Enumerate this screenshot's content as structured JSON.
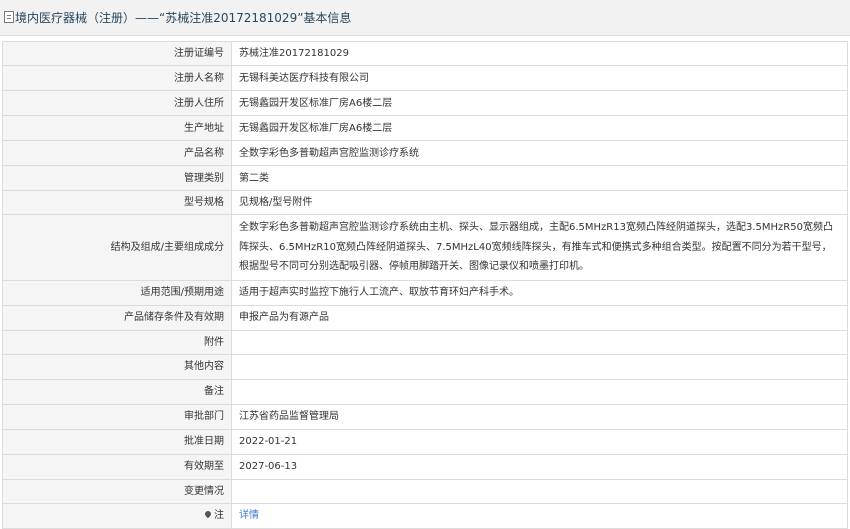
{
  "header": {
    "title": "境内医疗器械（注册）——“苏械注准20172181029”基本信息"
  },
  "rows": [
    {
      "label": "注册证编号",
      "value": "苏械注准20172181029"
    },
    {
      "label": "注册人名称",
      "value": "无锡科美达医疗科技有限公司"
    },
    {
      "label": "注册人住所",
      "value": "无锡蠡园开发区标准厂房A6楼二层"
    },
    {
      "label": "生产地址",
      "value": "无锡蠡园开发区标准厂房A6楼二层"
    },
    {
      "label": "产品名称",
      "value": "全数字彩色多普勒超声宫腔监测诊疗系统"
    },
    {
      "label": "管理类别",
      "value": "第二类"
    },
    {
      "label": "型号规格",
      "value": "见规格/型号附件"
    },
    {
      "label": "结构及组成/主要组成成分",
      "value": "全数字彩色多普勒超声宫腔监测诊疗系统由主机、探头、显示器组成，主配6.5MHzR13宽频凸阵经阴道探头，选配3.5MHzR50宽频凸阵探头、6.5MHzR10宽频凸阵经阴道探头、7.5MHzL40宽频线阵探头，有推车式和便携式多种组合类型。按配置不同分为若干型号，根据型号不同可分别选配吸引器、停帧用脚踏开关、图像记录仪和喷墨打印机。"
    },
    {
      "label": "适用范围/预期用途",
      "value": "适用于超声实时监控下施行人工流产、取放节育环妇产科手术。"
    },
    {
      "label": "产品储存条件及有效期",
      "value": "申报产品为有源产品"
    },
    {
      "label": "附件",
      "value": ""
    },
    {
      "label": "其他内容",
      "value": ""
    },
    {
      "label": "备注",
      "value": ""
    },
    {
      "label": "审批部门",
      "value": "江苏省药品监督管理局"
    },
    {
      "label": "批准日期",
      "value": "2022-01-21"
    },
    {
      "label": "有效期至",
      "value": "2027-06-13"
    },
    {
      "label": "变更情况",
      "value": ""
    },
    {
      "label": "注",
      "value": "详情"
    }
  ]
}
